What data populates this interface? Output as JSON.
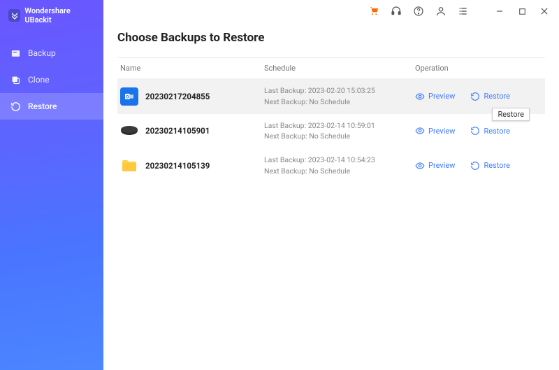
{
  "app": {
    "title": "Wondershare UBackit"
  },
  "sidebar": {
    "items": [
      {
        "label": "Backup"
      },
      {
        "label": "Clone"
      },
      {
        "label": "Restore"
      }
    ]
  },
  "page": {
    "title": "Choose Backups to Restore"
  },
  "columns": {
    "name": "Name",
    "schedule": "Schedule",
    "operation": "Operation"
  },
  "schedule_labels": {
    "last_prefix": "Last Backup: ",
    "next_prefix": "Next Backup: "
  },
  "actions": {
    "preview": "Preview",
    "restore": "Restore"
  },
  "tooltip": "Restore",
  "rows": [
    {
      "icon": "outlook",
      "name": "20230217204855",
      "last": "2023-02-20 15:03:25",
      "next": "No Schedule"
    },
    {
      "icon": "disk",
      "name": "20230214105901",
      "last": "2023-02-14 10:59:01",
      "next": "No Schedule"
    },
    {
      "icon": "folder",
      "name": "20230214105139",
      "last": "2023-02-14 10:54:23",
      "next": "No Schedule"
    }
  ]
}
